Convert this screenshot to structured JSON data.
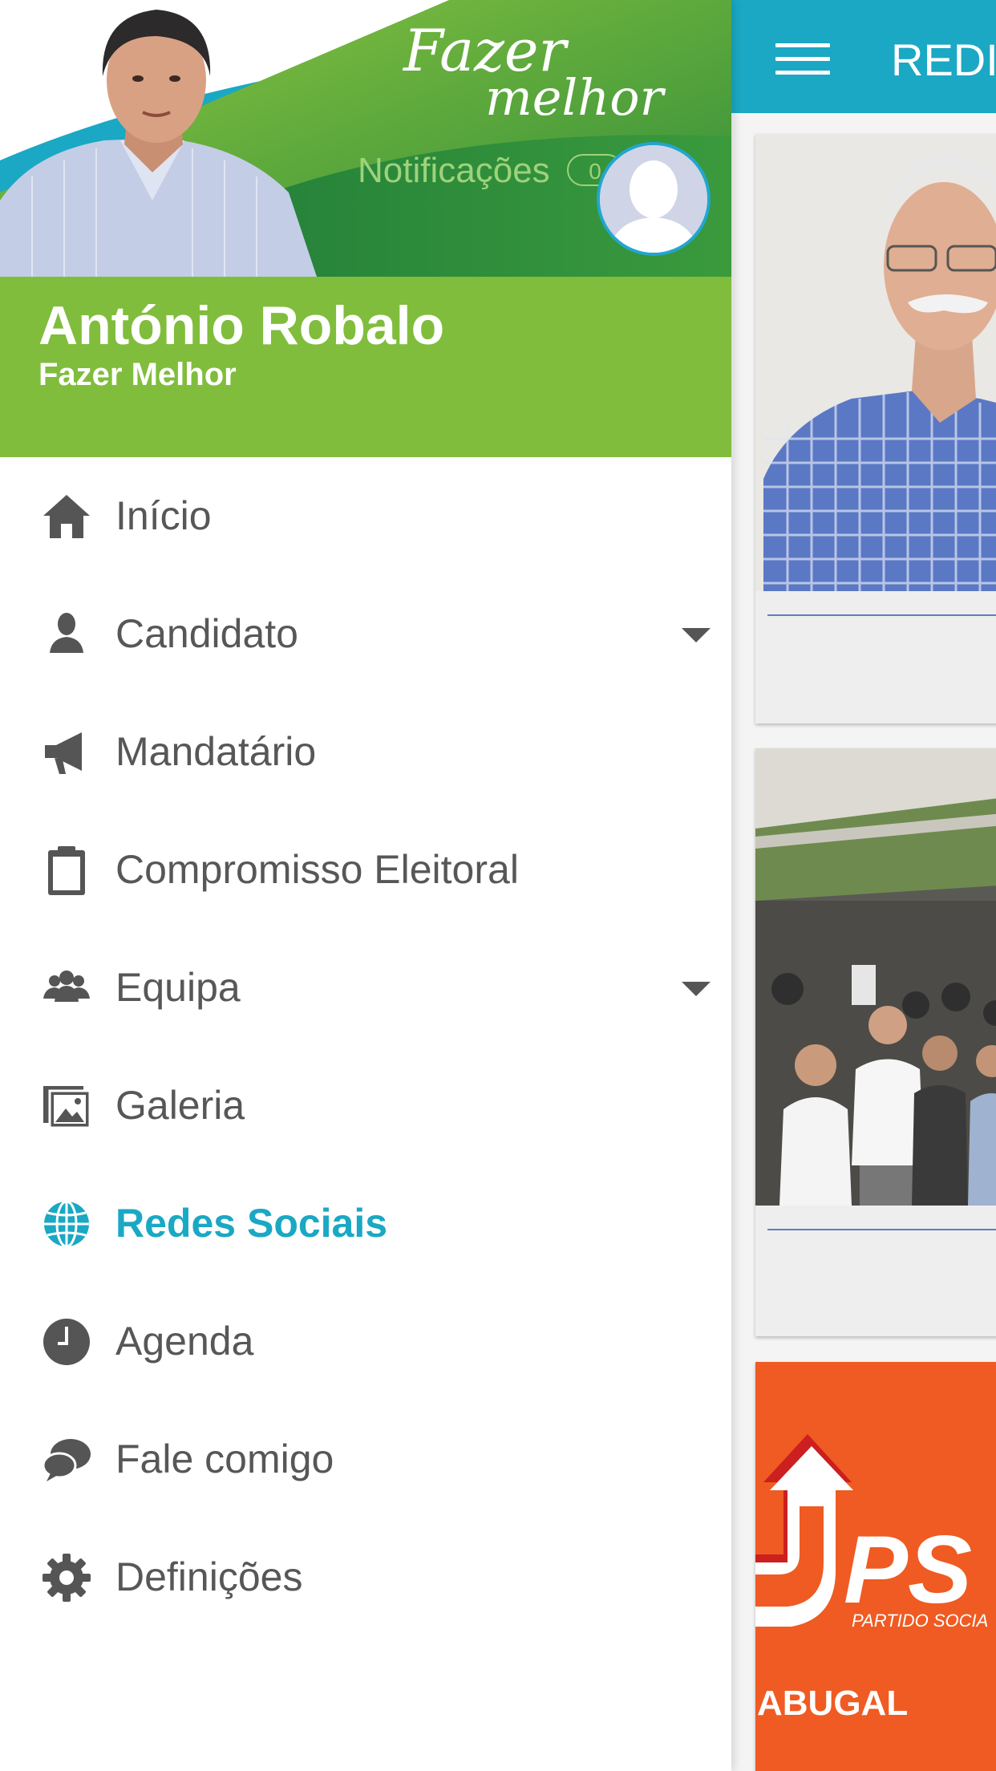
{
  "colors": {
    "accent": "#1aa8c4",
    "green": "#80bd3c",
    "text": "#575757",
    "ps_orange": "#ef5b22"
  },
  "drawer": {
    "banner": {
      "logo_line1": "Fazer",
      "logo_line2": "melhor",
      "notifications_label": "Notificações",
      "notifications_count": "0"
    },
    "user": {
      "name": "António Robalo",
      "slogan": "Fazer Melhor"
    },
    "menu": [
      {
        "label": "Início",
        "icon": "home-icon"
      },
      {
        "label": "Candidato",
        "icon": "person-icon",
        "expandable": true
      },
      {
        "label": "Mandatário",
        "icon": "megaphone-icon"
      },
      {
        "label": "Compromisso Eleitoral",
        "icon": "clipboard-icon"
      },
      {
        "label": "Equipa",
        "icon": "group-icon",
        "expandable": true
      },
      {
        "label": "Galeria",
        "icon": "gallery-icon"
      },
      {
        "label": "Redes Sociais",
        "icon": "globe-icon",
        "active": true
      },
      {
        "label": "Agenda",
        "icon": "clock-icon"
      },
      {
        "label": "Fale comigo",
        "icon": "chat-icon"
      },
      {
        "label": "Definições",
        "icon": "gear-icon"
      }
    ]
  },
  "content": {
    "topbar_title": "REDI",
    "posts": [
      {
        "image": "man-portrait-photo"
      },
      {
        "image": "market-crowd-photo"
      },
      {
        "image": "ps-party-poster",
        "text_logo": "PS",
        "text_party": "PARTIDO SOCIA",
        "text_place": "ABUGAL"
      }
    ]
  }
}
